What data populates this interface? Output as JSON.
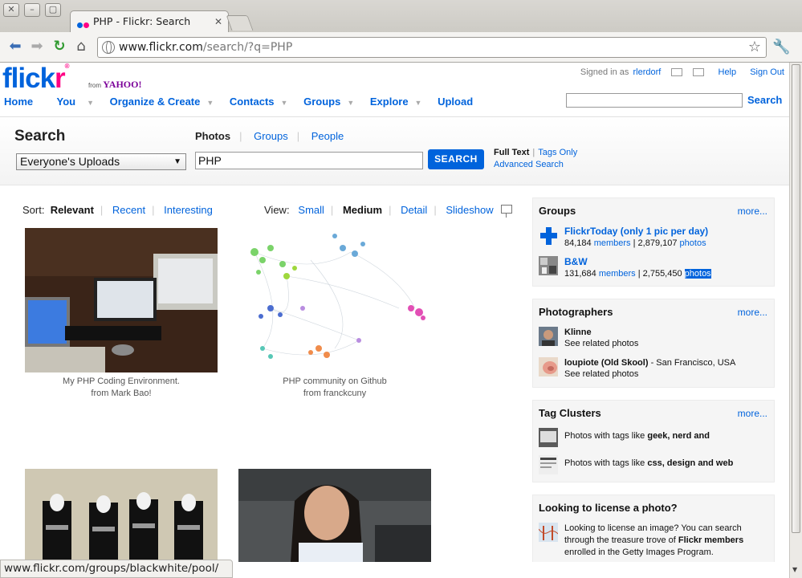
{
  "browser": {
    "tab_title": "PHP - Flickr: Search",
    "url_host": "www.flickr.com",
    "url_path": "/search/?q=PHP",
    "status_text": "www.flickr.com/groups/blackwhite/pool/"
  },
  "header": {
    "logo_blue": "flick",
    "logo_pink": "r",
    "logo_from": "from",
    "logo_yahoo": "YAHOO!",
    "signed_in_prefix": "Signed in as",
    "username": "rlerdorf",
    "help": "Help",
    "sign_out": "Sign Out",
    "nav": [
      "Home",
      "You",
      "Organize & Create",
      "Contacts",
      "Groups",
      "Explore",
      "Upload"
    ],
    "search_button": "Search"
  },
  "search": {
    "heading": "Search",
    "tabs": [
      "Photos",
      "Groups",
      "People"
    ],
    "scope": "Everyone's Uploads",
    "query": "PHP",
    "button": "SEARCH",
    "full_text": "Full Text",
    "tags_only": "Tags Only",
    "advanced": "Advanced Search"
  },
  "results": {
    "sort_label": "Sort:",
    "sort_options": [
      "Relevant",
      "Recent",
      "Interesting"
    ],
    "view_label": "View:",
    "view_options": [
      "Small",
      "Medium",
      "Detail",
      "Slideshow"
    ],
    "photos": [
      {
        "title": "My PHP Coding Environment.",
        "from": "from Mark Bao!"
      },
      {
        "title": "PHP community on Github",
        "from": "from franckcuny"
      },
      {
        "title": "",
        "from": ""
      },
      {
        "title": "",
        "from": ""
      }
    ]
  },
  "sidebar": {
    "more": "more...",
    "groups": {
      "title": "Groups",
      "items": [
        {
          "name": "FlickrToday (only 1 pic per day)",
          "members_count": "84,184",
          "members": "members",
          "photos_count": "2,879,107",
          "photos": "photos"
        },
        {
          "name": "B&W",
          "members_count": "131,684",
          "members": "members",
          "photos_count": "2,755,450",
          "photos": "photos"
        }
      ]
    },
    "photographers": {
      "title": "Photographers",
      "items": [
        {
          "name": "Klinne",
          "location": "",
          "sub": "See related photos"
        },
        {
          "name": "loupiote (Old Skool)",
          "location": "- San Francisco, USA",
          "sub": "See related photos"
        }
      ]
    },
    "tag_clusters": {
      "title": "Tag Clusters",
      "items": [
        {
          "prefix": "Photos with tags like",
          "tags": "geek, nerd and"
        },
        {
          "prefix": "Photos with tags like",
          "tags": "css, design and web"
        }
      ]
    },
    "license": {
      "title": "Looking to license a photo?",
      "line1": "Looking to license an image? You can search",
      "line2_prefix": "through the treasure trove of",
      "line2_bold": "Flickr members",
      "line3": "enrolled in the Getty Images Program."
    }
  },
  "colors": {
    "flickr_blue": "#0063dc",
    "flickr_pink": "#ff0084",
    "yahoo_purple": "#7b0099"
  }
}
